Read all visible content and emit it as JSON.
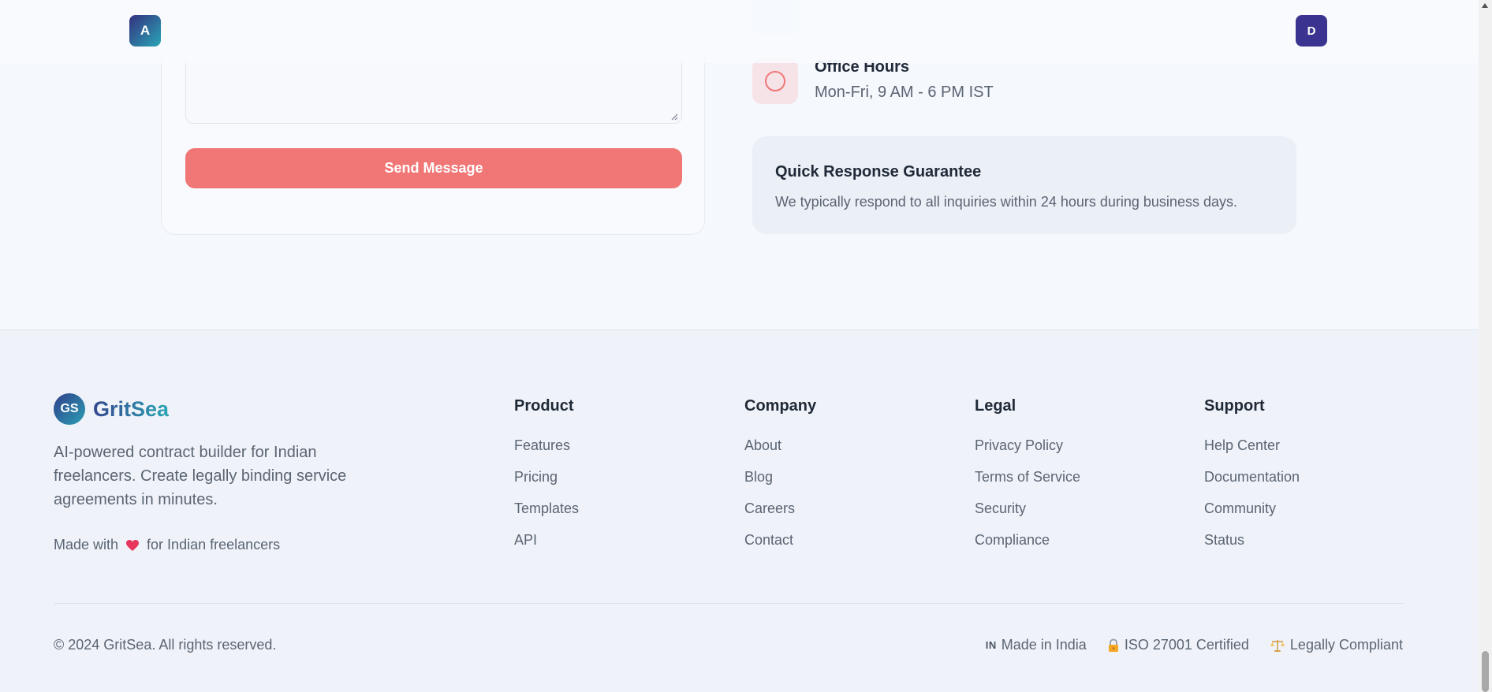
{
  "header": {
    "left_avatar": "A",
    "right_avatar": "D"
  },
  "contact": {
    "send_button": "Send Message",
    "office": {
      "title": "Office Hours",
      "value": "Mon-Fri, 9 AM - 6 PM IST",
      "icon": "clock-icon"
    },
    "quick": {
      "title": "Quick Response Guarantee",
      "text": "We typically respond to all inquiries within 24 hours during business days."
    }
  },
  "footer": {
    "brand": {
      "logo": "GS",
      "name": "GritSea",
      "description": "AI-powered contract builder for Indian freelancers. Create legally binding service agreements in minutes.",
      "made_with_prefix": "Made with",
      "made_with_suffix": "for Indian freelancers"
    },
    "columns": [
      {
        "title": "Product",
        "links": [
          "Features",
          "Pricing",
          "Templates",
          "API"
        ]
      },
      {
        "title": "Company",
        "links": [
          "About",
          "Blog",
          "Careers",
          "Contact"
        ]
      },
      {
        "title": "Legal",
        "links": [
          "Privacy Policy",
          "Terms of Service",
          "Security",
          "Compliance"
        ]
      },
      {
        "title": "Support",
        "links": [
          "Help Center",
          "Documentation",
          "Community",
          "Status"
        ]
      }
    ],
    "copyright": "© 2024 GritSea. All rights reserved.",
    "badges": [
      {
        "label": "Made in India",
        "flag": "IN",
        "icon": "india-flag-icon"
      },
      {
        "label": "ISO 27001 Certified",
        "icon": "lock-icon"
      },
      {
        "label": "Legally Compliant",
        "icon": "scales-icon"
      }
    ]
  },
  "colors": {
    "accent": "#f07776",
    "brand_dark": "#34307f",
    "brand_teal": "#2aa6b6",
    "heart": "#e8365d"
  }
}
